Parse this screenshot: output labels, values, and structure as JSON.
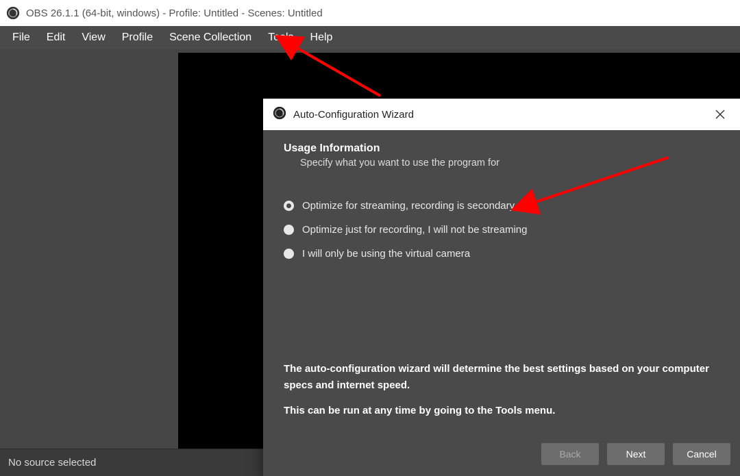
{
  "title_bar": {
    "text": "OBS 26.1.1 (64-bit, windows) - Profile: Untitled - Scenes: Untitled"
  },
  "menu": {
    "items": [
      "File",
      "Edit",
      "View",
      "Profile",
      "Scene Collection",
      "Tools",
      "Help"
    ]
  },
  "status_bar": {
    "text": "No source selected"
  },
  "wizard": {
    "title": "Auto-Configuration Wizard",
    "section_title": "Usage Information",
    "section_sub": "Specify what you want to use the program for",
    "options": [
      {
        "label": "Optimize for streaming, recording is secondary",
        "selected": true
      },
      {
        "label": "Optimize just for recording, I will not be streaming",
        "selected": false
      },
      {
        "label": "I will only be using the virtual camera",
        "selected": false
      }
    ],
    "info_line1": "The auto-configuration wizard will determine the best settings based on your computer specs and internet speed.",
    "info_line2": "This can be run at any time by going to the Tools menu.",
    "buttons": {
      "back": "Back",
      "next": "Next",
      "cancel": "Cancel"
    }
  }
}
